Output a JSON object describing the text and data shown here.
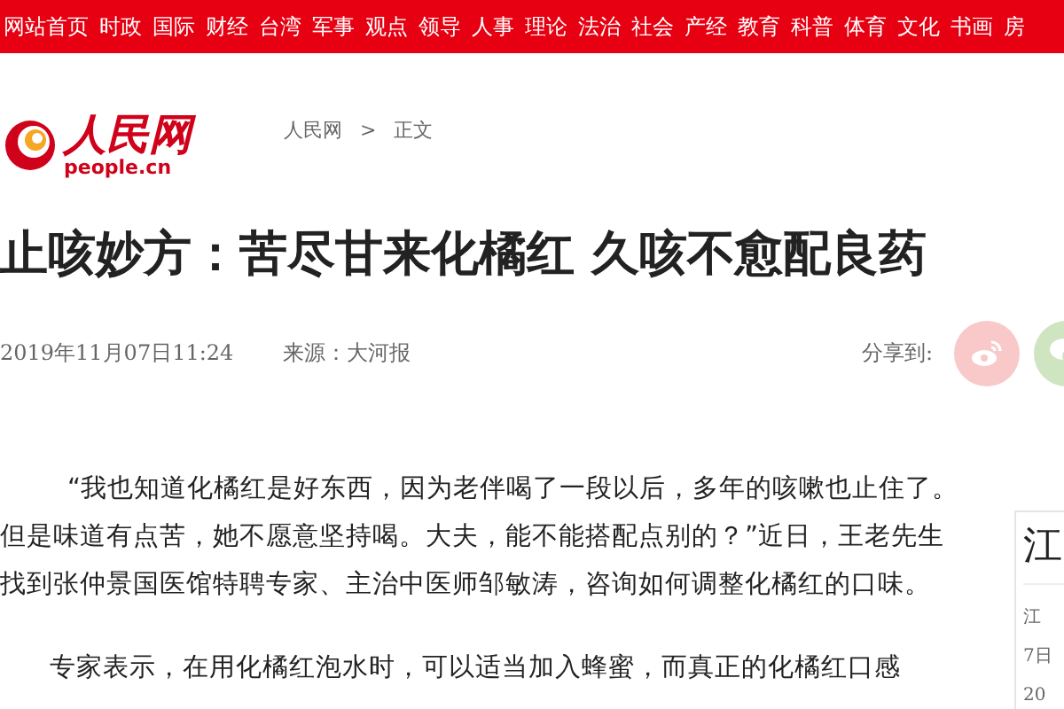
{
  "nav": {
    "items": [
      "网站首页",
      "时政",
      "国际",
      "财经",
      "台湾",
      "军事",
      "观点",
      "领导",
      "人事",
      "理论",
      "法治",
      "社会",
      "产经",
      "教育",
      "科普",
      "体育",
      "文化",
      "书画",
      "房"
    ]
  },
  "logo": {
    "title": "人民网",
    "domain": "people.cn"
  },
  "breadcrumb": {
    "items": [
      "人民网",
      "正文"
    ],
    "separator": ">"
  },
  "headline": "止咳妙方：苦尽甘来化橘红 久咳不愈配良药",
  "meta": {
    "date": "2019年11月07日11:24",
    "source": "来源：大河报"
  },
  "share": {
    "label": "分享到:",
    "buttons": [
      {
        "kind": "weibo"
      },
      {
        "kind": "wechat"
      }
    ]
  },
  "article": {
    "paragraphs": [
      {
        "lines": [
          "“我也知道化橘红是好东西，因为老伴喝了一段以后，多年的咳嗽也止住了。",
          "但是味道有点苦，她不愿意坚持喝。大夫，能不能搭配点别的？”近日，王老先生",
          "找到张仲景国医馆特聘专家、主治中医师邹敏涛，咨询如何调整化橘红的口味。"
        ]
      },
      {
        "lines": [
          "专家表示，在用化橘红泡水时，可以适当加入蜂蜜，而真正的化橘红口感"
        ]
      }
    ]
  },
  "sidebar": {
    "title": "江",
    "items": [
      "江",
      "7日",
      "20"
    ]
  }
}
